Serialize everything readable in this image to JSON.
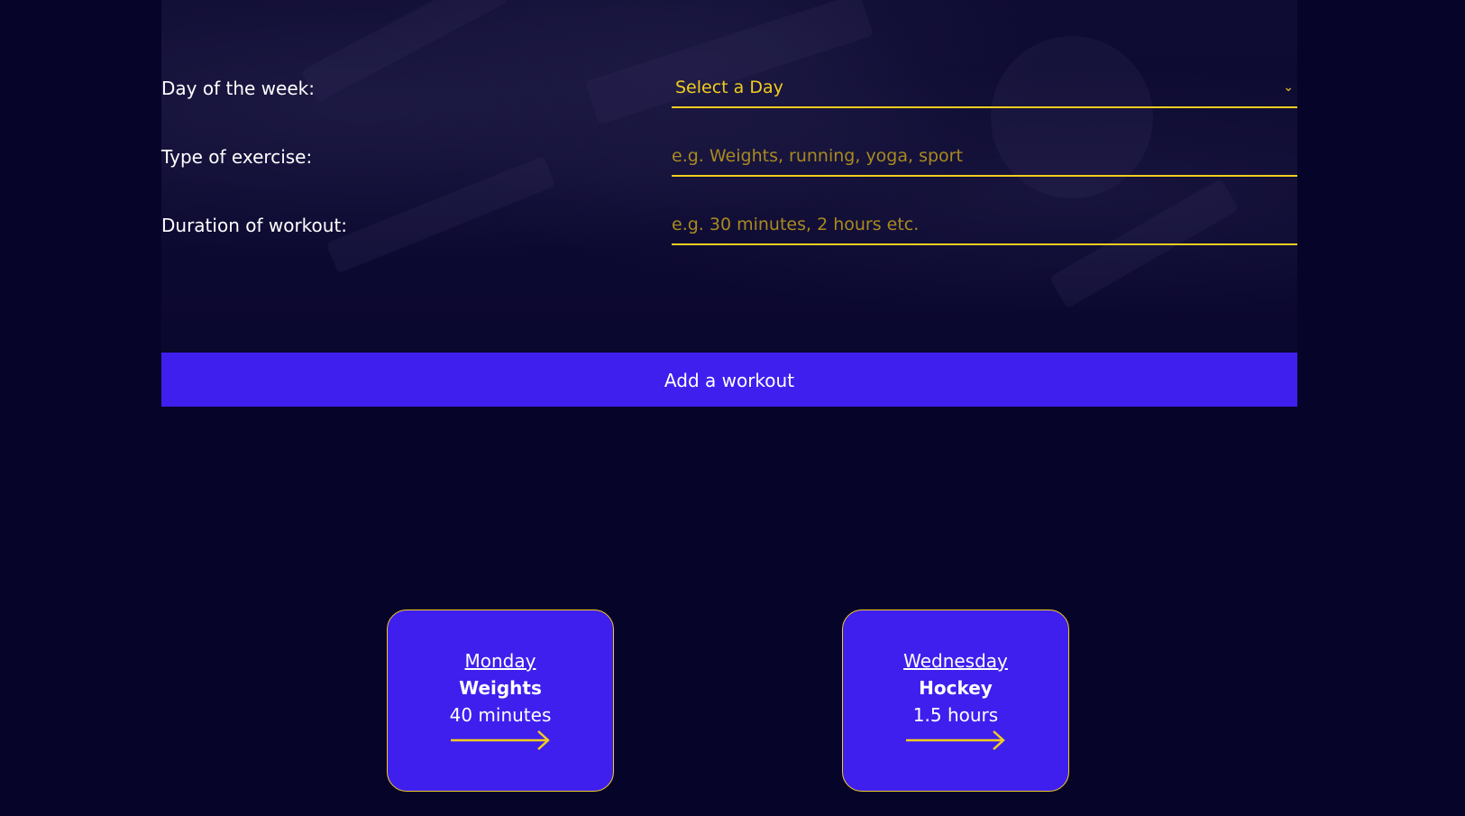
{
  "form": {
    "day_label": "Day of the week:",
    "day_select_value": "Select a Day",
    "type_label": "Type of exercise:",
    "type_placeholder": "e.g. Weights, running, yoga, sport",
    "duration_label": "Duration of workout:",
    "duration_placeholder": "e.g. 30 minutes, 2 hours etc.",
    "submit_label": "Add a workout"
  },
  "workouts": [
    {
      "day": "Monday",
      "type": "Weights",
      "duration": "40 minutes"
    },
    {
      "day": "Wednesday",
      "type": "Hockey",
      "duration": "1.5 hours"
    }
  ],
  "icons": {
    "select": "chevron-down-icon",
    "card_arrow": "arrow-right-icon"
  },
  "colors": {
    "background": "#07042a",
    "accent": "#3e1fee",
    "highlight": "#f2cd1e",
    "placeholder": "#a98a1f"
  }
}
